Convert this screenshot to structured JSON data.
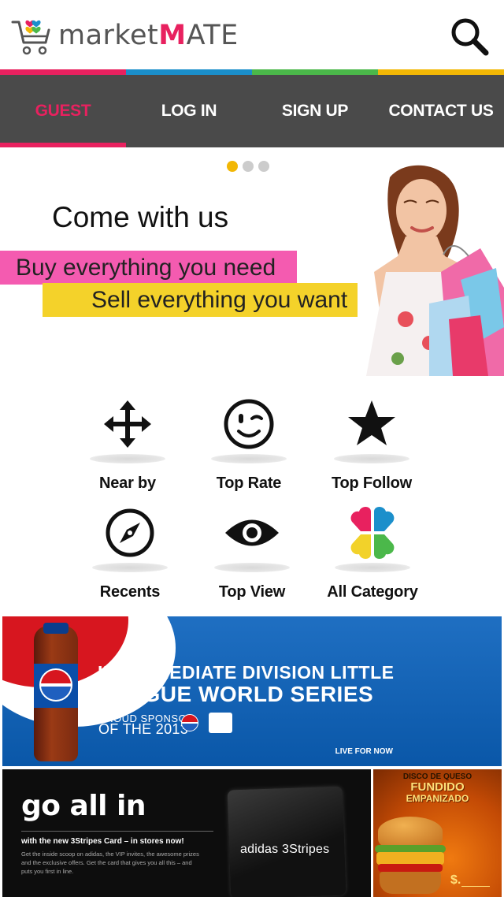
{
  "app": {
    "logo_prefix": "market",
    "logo_suffix": "ATE",
    "logo_m": "M"
  },
  "colors": {
    "pink": "#e8215f",
    "blue": "#1b8fcb",
    "green": "#4bb84a",
    "yellow": "#f2b705",
    "nav_bg": "#4a4a4a"
  },
  "nav": {
    "items": [
      {
        "label": "GUEST",
        "active": true
      },
      {
        "label": "LOG IN",
        "active": false
      },
      {
        "label": "SIGN UP",
        "active": false
      },
      {
        "label": "CONTACT US",
        "active": false
      }
    ]
  },
  "hero": {
    "headline": "Come with us",
    "line1": "Buy everything you need",
    "line2": "Sell everything you want",
    "slides_total": 3,
    "active_slide": 1
  },
  "features": [
    {
      "label": "Near by",
      "icon": "move-arrows-icon"
    },
    {
      "label": "Top Rate",
      "icon": "wink-smiley-icon"
    },
    {
      "label": "Top Follow",
      "icon": "star-icon"
    },
    {
      "label": "Recents",
      "icon": "compass-icon"
    },
    {
      "label": "Top View",
      "icon": "eye-icon"
    },
    {
      "label": "All Category",
      "icon": "clover-hearts-icon"
    }
  ],
  "ads": {
    "pepsi": {
      "title1": "INTERMEDIATE DIVISION LITTLE",
      "title2": "LEAGUE WORLD SERIES",
      "sub1": "PROUD SPONSOR",
      "sub2": "OF THE 2013",
      "bottle_label": "pepsi",
      "tagline": "LIVE FOR NOW"
    },
    "adidas": {
      "headline": "go all in",
      "sub": "with the new 3Stripes Card – in stores now!",
      "body": "Get the inside scoop on adidas, the VIP invites, the awesome prizes and the exclusive offers. Get the card that gives you all this – and puts you first in line.",
      "card": "adidas 3Stripes"
    },
    "burger": {
      "line1": "DISCO DE QUESO",
      "line2": "FUNDIDO",
      "line3": "EMPANIZADO",
      "price": "$."
    }
  }
}
